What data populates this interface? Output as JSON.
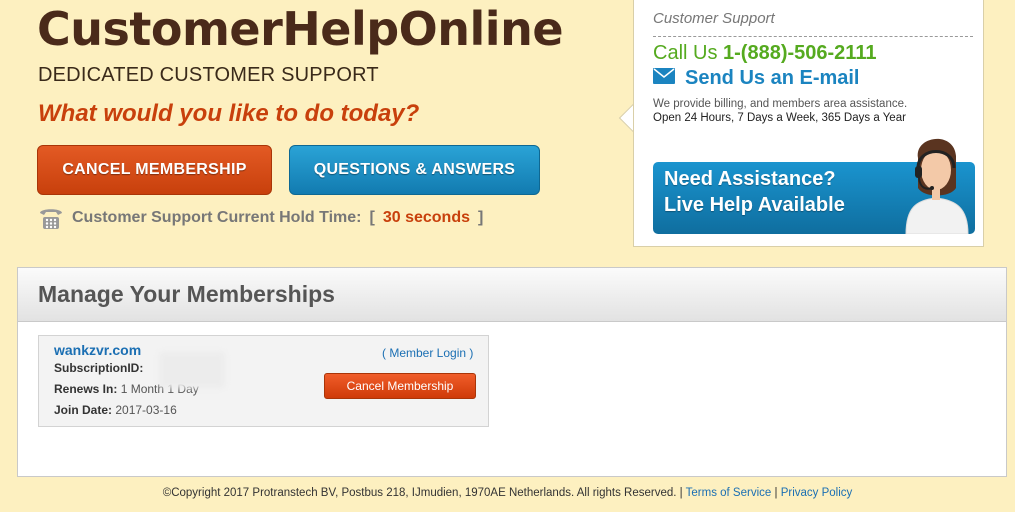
{
  "header": {
    "brand": "CustomerHelpOnline",
    "tagline": "DEDICATED CUSTOMER SUPPORT",
    "question": "What would you like to do today?",
    "cancel_button": "CANCEL MEMBERSHIP",
    "qa_button": "QUESTIONS & ANSWERS",
    "hold_label": "Customer Support Current Hold Time:",
    "hold_open": "[",
    "hold_value": "30 seconds",
    "hold_close": "]"
  },
  "support": {
    "label": "Customer Support",
    "call_prefix": "Call Us",
    "phone": "1-(888)-506-2111",
    "email_label": "Send Us an E-mail",
    "assist_line1": "We provide billing, and members area assistance.",
    "assist_line2": "Open 24 Hours, 7 Days a Week, 365 Days a Year",
    "need_line1": "Need Assistance?",
    "need_line2": "Live Help Available"
  },
  "manage": {
    "title": "Manage Your Memberships",
    "membership": {
      "site": "wankzvr.com",
      "subscription_label": "SubscriptionID:",
      "subscription_value": "",
      "renews_label": "Renews In:",
      "renews_value": "1 Month 1 Day",
      "join_label": "Join Date:",
      "join_value": "2017-03-16",
      "login_link": "( Member Login )",
      "cancel_button": "Cancel Membership"
    }
  },
  "footer": {
    "copyright": "©Copyright 2017 Protranstech BV, Postbus 218, IJmudien, 1970AE Netherlands. All rights Reserved.",
    "sep1": "|",
    "terms": "Terms of Service",
    "sep2": "|",
    "privacy": "Privacy Policy"
  },
  "colors": {
    "background": "#fdf0c0",
    "accent_orange": "#c8400c",
    "accent_blue": "#1b84c0",
    "call_green": "#55aa1f"
  },
  "icons": [
    "phone-icon",
    "envelope-icon",
    "agent-headset-icon"
  ]
}
